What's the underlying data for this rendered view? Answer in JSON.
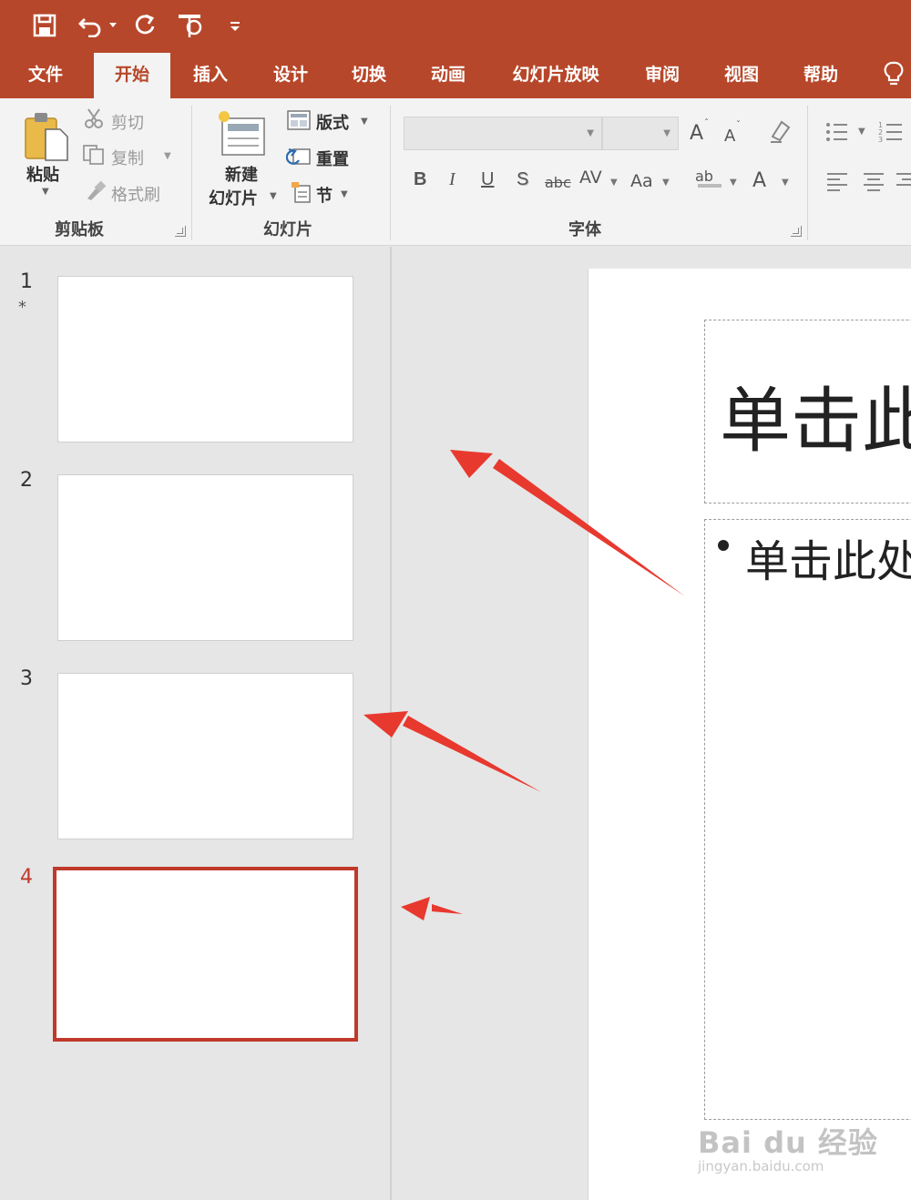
{
  "quick_access": {
    "icons": [
      "save-icon",
      "undo-icon",
      "dropdown-icon",
      "redo-icon",
      "slideshow-start-icon",
      "customize-icon"
    ]
  },
  "tabs": [
    {
      "label": "文件"
    },
    {
      "label": "开始",
      "active": true
    },
    {
      "label": "插入"
    },
    {
      "label": "设计"
    },
    {
      "label": "切换"
    },
    {
      "label": "动画"
    },
    {
      "label": "幻灯片放映"
    },
    {
      "label": "审阅"
    },
    {
      "label": "视图"
    },
    {
      "label": "帮助"
    }
  ],
  "ribbon": {
    "clipboard": {
      "paste": "粘贴",
      "cut": "剪切",
      "copy": "复制",
      "format_painter": "格式刷",
      "group": "剪贴板"
    },
    "slides": {
      "new_slide_line1": "新建",
      "new_slide_line2": "幻灯片",
      "layout": "版式",
      "reset": "重置",
      "section": "节",
      "group": "幻灯片"
    },
    "font": {
      "bold": "B",
      "italic": "I",
      "underline": "U",
      "shadow": "S",
      "strikethrough": "abc",
      "spacing": "AV",
      "change_case": "Aa",
      "highlight": "ab",
      "font_color": "A",
      "grow": "A",
      "shrink": "A",
      "group": "字体"
    }
  },
  "thumbnails": [
    {
      "number": "1",
      "star": "*"
    },
    {
      "number": "2"
    },
    {
      "number": "3"
    },
    {
      "number": "4",
      "selected": true
    }
  ],
  "slide": {
    "title": "单击此处添加标题",
    "body": "单击此处添加文本"
  },
  "watermark": {
    "brand": "Bai du 经验",
    "url": "jingyan.baidu.com"
  },
  "colors": {
    "accent": "#b7472a",
    "selection": "#c0392b",
    "annotation_arrow": "#e8392f"
  }
}
